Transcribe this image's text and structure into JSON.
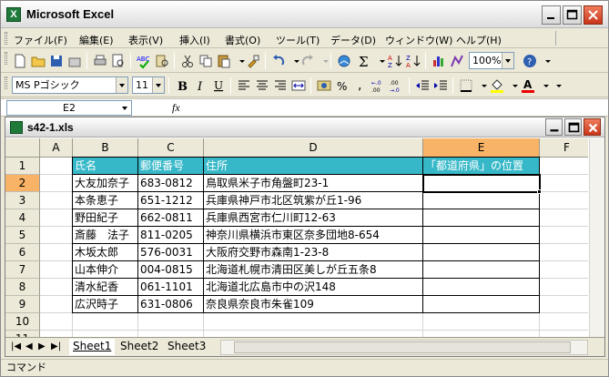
{
  "window": {
    "title": "Microsoft Excel",
    "icon": "excel-app-icon"
  },
  "menu": [
    {
      "label": "ファイル(F)"
    },
    {
      "label": "編集(E)"
    },
    {
      "label": "表示(V)"
    },
    {
      "label": "挿入(I)"
    },
    {
      "label": "書式(O)"
    },
    {
      "label": "ツール(T)"
    },
    {
      "label": "データ(D)"
    },
    {
      "label": "ウィンドウ(W)"
    },
    {
      "label": "ヘルプ(H)"
    }
  ],
  "toolbar": {
    "zoom": "100%"
  },
  "format_toolbar": {
    "font_name": "MS Pゴシック",
    "font_size": "11"
  },
  "formula": {
    "cell_ref": "E2",
    "fx_label": "fx",
    "content": ""
  },
  "workbook": {
    "title": "s42-1.xls"
  },
  "sheet": {
    "columns": [
      "A",
      "B",
      "C",
      "D",
      "E",
      "F"
    ],
    "rows": [
      "1",
      "2",
      "3",
      "4",
      "5",
      "6",
      "7",
      "8",
      "9",
      "10",
      "11"
    ],
    "header": {
      "name": "氏名",
      "zip": "郵便番号",
      "address": "住所",
      "pref": "「都道府県」の位置"
    },
    "data": [
      {
        "name": "大友加奈子",
        "zip": "683-0812",
        "address": "鳥取県米子市角盤町23-1"
      },
      {
        "name": "本条恵子",
        "zip": "651-1212",
        "address": "兵庫県神戸市北区筑紫が丘1-96"
      },
      {
        "name": "野田紀子",
        "zip": "662-0811",
        "address": "兵庫県西宮市仁川町12-63"
      },
      {
        "name": "斎藤　法子",
        "zip": "811-0205",
        "address": "神奈川県横浜市東区奈多団地8-654"
      },
      {
        "name": "木坂太郎",
        "zip": "576-0031",
        "address": "大阪府交野市森南1-23-8"
      },
      {
        "name": "山本伸介",
        "zip": "004-0815",
        "address": "北海道札幌市清田区美しが丘五条8"
      },
      {
        "name": "清水紀香",
        "zip": "061-1101",
        "address": "北海道北広島市中の沢148"
      },
      {
        "name": "広沢時子",
        "zip": "631-0806",
        "address": "奈良県奈良市朱雀109"
      }
    ]
  },
  "tabs": [
    {
      "label": "Sheet1",
      "active": true
    },
    {
      "label": "Sheet2"
    },
    {
      "label": "Sheet3"
    }
  ],
  "status": {
    "mode": "コマンド"
  },
  "colors": {
    "header_fill": "#37b8c8",
    "active_header": "#f8b366"
  }
}
